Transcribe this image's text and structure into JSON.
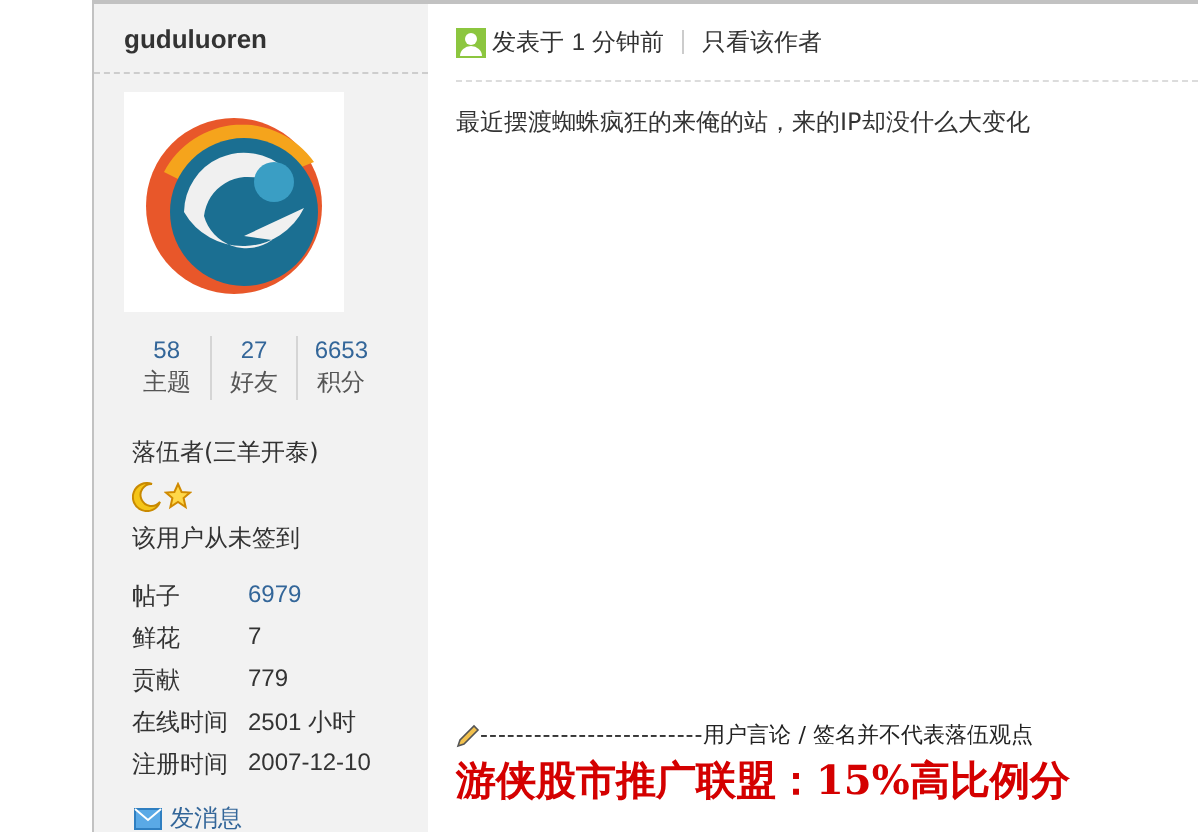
{
  "author": {
    "name": "guduluoren"
  },
  "stats": [
    {
      "value": "58",
      "label": "主题"
    },
    {
      "value": "27",
      "label": "好友"
    },
    {
      "value": "6653",
      "label": "积分"
    }
  ],
  "rank": "落伍者(三羊开泰)",
  "signin_status": "该用户从未签到",
  "profile": [
    {
      "label": "帖子",
      "value": "6979",
      "link": true
    },
    {
      "label": "鲜花",
      "value": "7",
      "link": false
    },
    {
      "label": "贡献",
      "value": "779",
      "link": false
    },
    {
      "label": "在线时间",
      "value": "2501 小时",
      "link": false
    },
    {
      "label": "注册时间",
      "value": "2007-12-10",
      "link": false
    }
  ],
  "send_message": "发消息",
  "post": {
    "posted_label": "发表于",
    "posted_time": "1 分钟前",
    "author_only": "只看该作者",
    "body": "最近摆渡蜘蛛疯狂的来俺的站，来的IP却没什么大变化"
  },
  "signature": {
    "dashes": "-------------------------",
    "disclaimer": "用户言论 / 签名并不代表落伍观点",
    "banner": "游侠股市推广联盟：15%高比例分"
  }
}
